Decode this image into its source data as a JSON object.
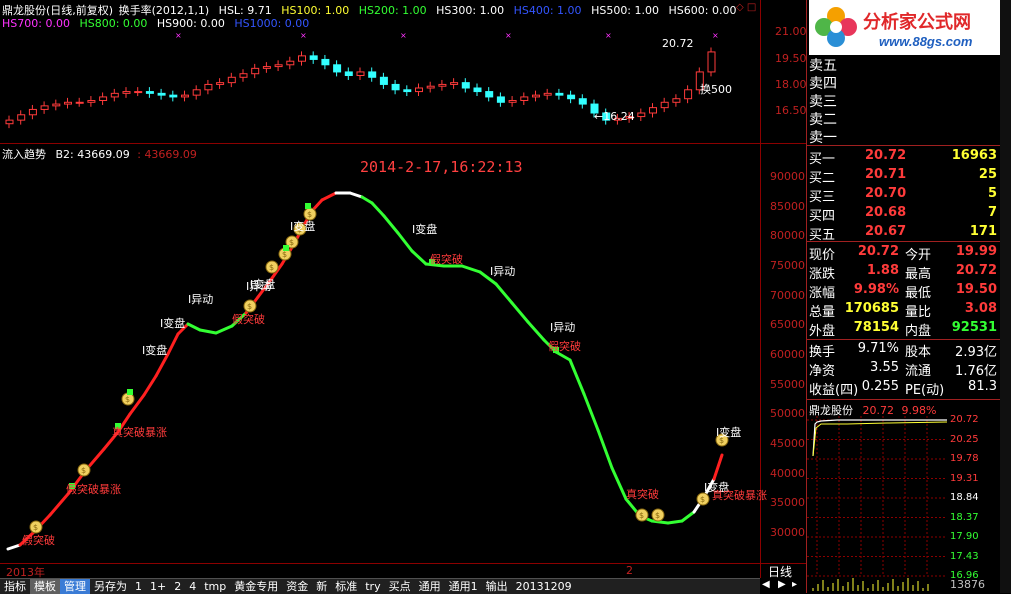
{
  "top_panel": {
    "title": "鼎龙股份(日线,前复权)",
    "indicator": "换手率(2012,1,1)",
    "legend_row1": [
      {
        "label": "HSL: 9.71",
        "color": "#ffffff"
      },
      {
        "label": "HS100: 1.00",
        "color": "#ffff33"
      },
      {
        "label": "HS200: 1.00",
        "color": "#33ff33"
      },
      {
        "label": "HS300: 1.00",
        "color": "#ffffff"
      },
      {
        "label": "HS400: 1.00",
        "color": "#3355ff"
      },
      {
        "label": "HS500: 1.00",
        "color": "#ffffff"
      },
      {
        "label": "HS600: 0.00",
        "color": "#ffffff"
      }
    ],
    "legend_row2": [
      {
        "label": "HS700: 0.00",
        "color": "#ff33ff"
      },
      {
        "label": "HS800: 0.00",
        "color": "#33ff33"
      },
      {
        "label": "HS900: 0.00",
        "color": "#ffffff"
      },
      {
        "label": "HS1000: 0.00",
        "color": "#3355ff"
      }
    ],
    "y_ticks": [
      "21.00",
      "19.50",
      "18.00",
      "16.50"
    ],
    "labels": {
      "high": "20.72",
      "low": "16.24",
      "turnover": "换500"
    }
  },
  "bottom_panel": {
    "title": "流入趋势",
    "b2_label": "B2: 43669.09",
    "b2_value": "43669.09",
    "date_label": "2014-2-17,16:22:13",
    "y_ticks": [
      "90000",
      "85000",
      "80000",
      "75000",
      "70000",
      "65000",
      "60000",
      "55000",
      "50000",
      "45000",
      "40000",
      "35000",
      "30000"
    ],
    "annotations": [
      {
        "text": "假突破",
        "color": "#ff3b3b"
      },
      {
        "text": "假突破暴涨",
        "color": "#ff3b3b"
      },
      {
        "text": "真突破暴涨",
        "color": "#ff3b3b"
      },
      {
        "text": "I变盘",
        "color": "#ffffff"
      },
      {
        "text": "I变盘",
        "color": "#ffffff"
      },
      {
        "text": "I异动",
        "color": "#ffffff"
      },
      {
        "text": "假突破",
        "color": "#ff3b3b"
      },
      {
        "text": "I异动",
        "color": "#ffffff"
      },
      {
        "text": "I变盘",
        "color": "#ffffff"
      },
      {
        "text": "I变盘",
        "color": "#ffffff"
      },
      {
        "text": "I变盘",
        "color": "#ffffff"
      },
      {
        "text": "假突破",
        "color": "#ff3b3b"
      },
      {
        "text": "I异动",
        "color": "#ffffff"
      },
      {
        "text": "I异动",
        "color": "#ffffff"
      },
      {
        "text": "假突破",
        "color": "#ff3b3b"
      },
      {
        "text": "真突破",
        "color": "#ff3b3b"
      },
      {
        "text": "I变盘",
        "color": "#ffffff"
      },
      {
        "text": "I变盘",
        "color": "#ffffff"
      },
      {
        "text": "真突破暴涨",
        "color": "#ff3b3b"
      }
    ]
  },
  "x_axis": {
    "year_label": "2013年",
    "month_label": "2",
    "period": "日线"
  },
  "bottom_bar": {
    "tabs": [
      "指标",
      "模板",
      "管理",
      "另存为",
      "1",
      "1+",
      "2",
      "4",
      "tmp",
      "黄金专用",
      "资金",
      "新",
      "标准",
      "try",
      "买点",
      "通用",
      "通用1",
      "输出",
      "20131209"
    ]
  },
  "ad": {
    "brand": "分析家公式网",
    "url": "www.88gs.com"
  },
  "order_book": {
    "sell": [
      {
        "label": "卖五",
        "price": "",
        "vol": ""
      },
      {
        "label": "卖四",
        "price": "",
        "vol": ""
      },
      {
        "label": "卖三",
        "price": "",
        "vol": ""
      },
      {
        "label": "卖二",
        "price": "",
        "vol": ""
      },
      {
        "label": "卖一",
        "price": "",
        "vol": ""
      }
    ],
    "buy": [
      {
        "label": "买一",
        "price": "20.72",
        "vol": "16963"
      },
      {
        "label": "买二",
        "price": "20.71",
        "vol": "25"
      },
      {
        "label": "买三",
        "price": "20.70",
        "vol": "5"
      },
      {
        "label": "买四",
        "price": "20.68",
        "vol": "7"
      },
      {
        "label": "买五",
        "price": "20.67",
        "vol": "171"
      }
    ]
  },
  "stats": [
    {
      "l1": "现价",
      "v1": "20.72",
      "l2": "今开",
      "v2": "19.99"
    },
    {
      "l1": "涨跌",
      "v1": "1.88",
      "l2": "最高",
      "v2": "20.72"
    },
    {
      "l1": "涨幅",
      "v1": "9.98%",
      "l2": "最低",
      "v2": "19.50"
    },
    {
      "l1": "总量",
      "v1": "170685",
      "l2": "量比",
      "v2": "3.08"
    },
    {
      "l1": "外盘",
      "v1": "78154",
      "l2": "内盘",
      "v2": "92531"
    }
  ],
  "stats2": [
    {
      "l1": "换手",
      "v1": "9.71%",
      "l2": "股本",
      "v2": "2.93亿"
    },
    {
      "l1": "净资",
      "v1": "3.55",
      "l2": "流通",
      "v2": "1.76亿"
    },
    {
      "l1": "收益(四)",
      "v1": "0.255",
      "l2": "PE(动)",
      "v2": "81.3"
    }
  ],
  "mini_chart": {
    "name": "鼎龙股份",
    "price": "20.72",
    "pct": "9.98%",
    "y_ticks": [
      "20.72",
      "20.25",
      "19.78",
      "19.31",
      "18.84",
      "18.37",
      "17.90",
      "17.43",
      "16.96"
    ],
    "volume": "13876"
  }
}
